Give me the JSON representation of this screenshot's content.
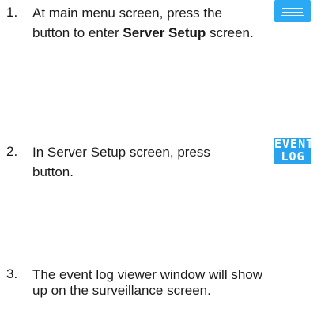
{
  "steps": [
    {
      "number": "1.",
      "line1": "At main menu screen, press the",
      "line2_pre": "button to enter ",
      "line2_bold": "Server Setup",
      "line2_post": " screen.",
      "button_icon": "server-setup-icon"
    },
    {
      "number": "2.",
      "line1": "In Server Setup screen, press",
      "line2": "button.",
      "button_label_top": "EVENT",
      "button_label_bottom": "LOG"
    },
    {
      "number": "3.",
      "line1": "The event log viewer window will show",
      "line2": "up on the surveillance screen."
    }
  ],
  "colors": {
    "button_blue": "#2ba9f2",
    "text": "#1a1a1a"
  }
}
